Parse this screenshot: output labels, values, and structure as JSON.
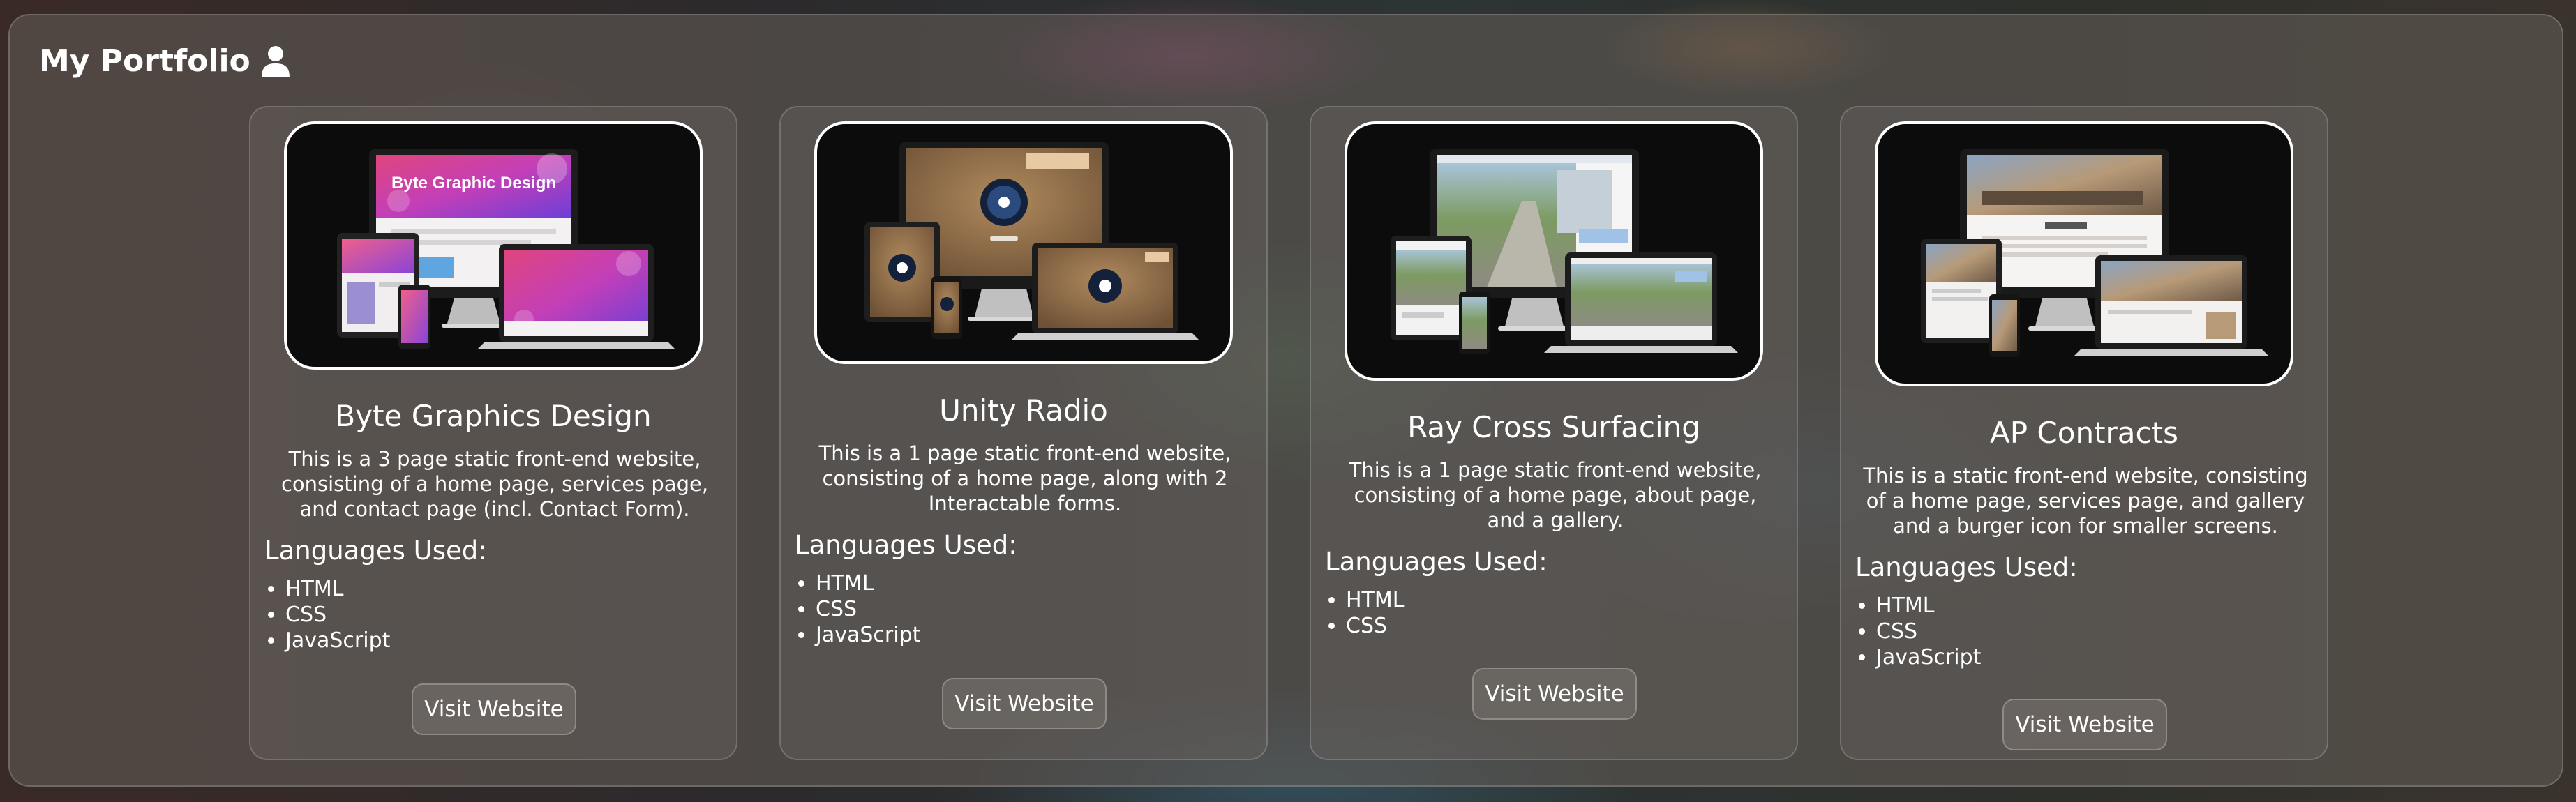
{
  "header": {
    "title": "My Portfolio",
    "icon": "user-icon"
  },
  "cards": [
    {
      "title": "Byte Graphics Design",
      "description": "This is a 3 page static front-end website, consisting of a home page, services page, and contact page (incl. Contact Form).",
      "languages_heading": "Languages Used:",
      "languages": [
        "HTML",
        "CSS",
        "JavaScript"
      ],
      "button_label": "Visit Website",
      "image": {
        "screen_text": "Byte Graphic Design",
        "accent": "#c9409c"
      }
    },
    {
      "title": "Unity Radio",
      "description": "This is a 1 page static front-end website, consisting of a home page, along with 2 Interactable forms.",
      "languages_heading": "Languages Used:",
      "languages": [
        "HTML",
        "CSS",
        "JavaScript"
      ],
      "button_label": "Visit Website",
      "image": {
        "accent": "#8a6a48"
      }
    },
    {
      "title": "Ray Cross Surfacing",
      "description": "This is a 1 page static front-end website, consisting of a home page, about page, and a gallery.",
      "languages_heading": "Languages Used:",
      "languages": [
        "HTML",
        "CSS"
      ],
      "button_label": "Visit Website",
      "image": {
        "accent": "#8fb36a"
      }
    },
    {
      "title": "AP Contracts",
      "description": "This is a static front-end website, consisting of a home page, services page, and gallery and a burger icon for smaller screens.",
      "languages_heading": "Languages Used:",
      "languages": [
        "HTML",
        "CSS",
        "JavaScript"
      ],
      "button_label": "Visit Website",
      "image": {
        "accent": "#b79a78"
      }
    }
  ]
}
